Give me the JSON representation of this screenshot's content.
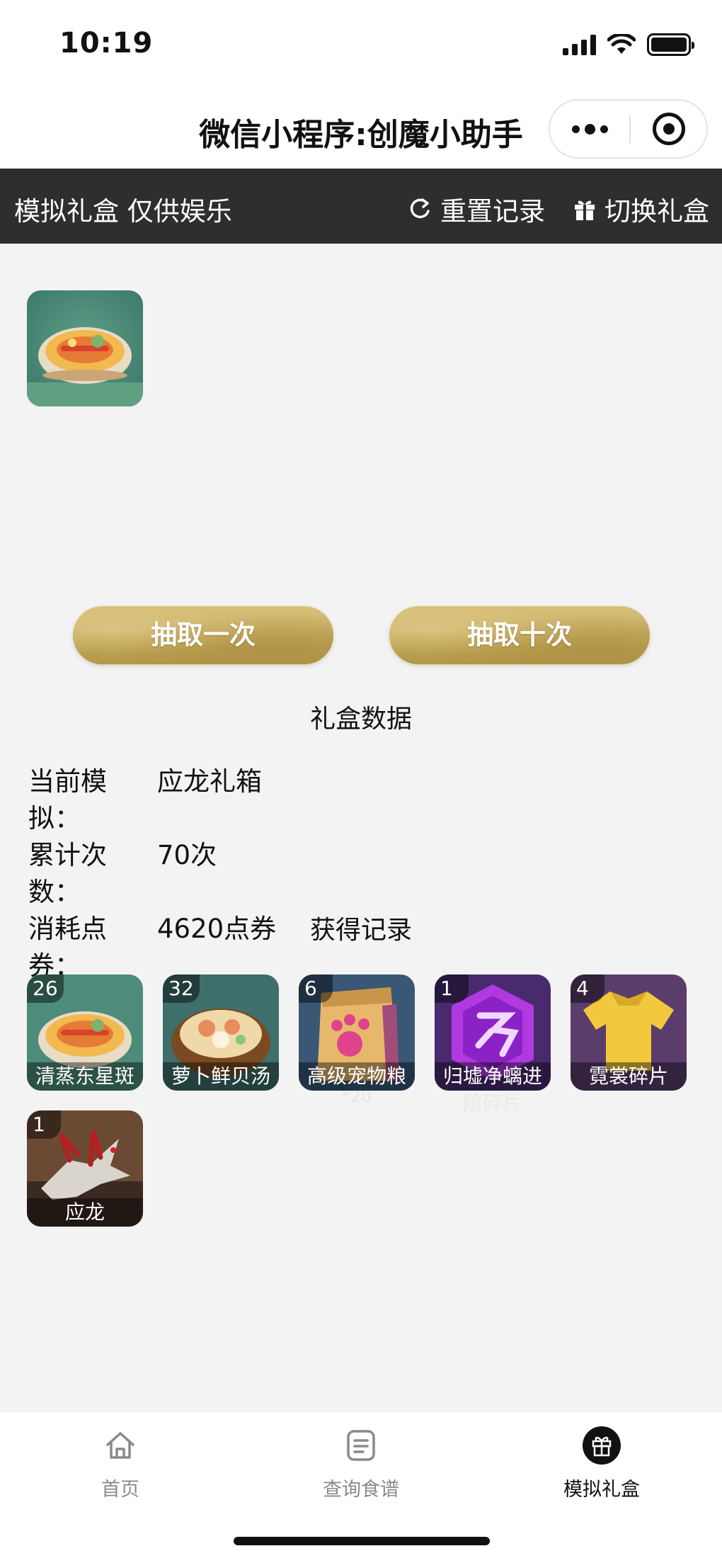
{
  "status_bar": {
    "time": "10:19"
  },
  "nav": {
    "title": "微信小程序:创魔小助手"
  },
  "top_bar": {
    "left_text": "模拟礼盒 仅供娱乐",
    "reset_label": "重置记录",
    "switch_label": "切换礼盒"
  },
  "buttons": {
    "draw_one": "抽取一次",
    "draw_ten": "抽取十次"
  },
  "stats": {
    "title": "礼盒数据",
    "rows": [
      {
        "label": "当前模拟：",
        "value": "应龙礼箱"
      },
      {
        "label": "累计次数：",
        "value": "70次"
      },
      {
        "label": "消耗点券：",
        "value": "4620点券"
      }
    ]
  },
  "records": {
    "title": "获得记录",
    "items": [
      {
        "count": "26",
        "name": "清蒸东星斑"
      },
      {
        "count": "32",
        "name": "萝卜鲜贝汤"
      },
      {
        "count": "6",
        "name": "高级宠物粮",
        "sub": "*20"
      },
      {
        "count": "1",
        "name": "归墟净螭进",
        "name2": "阶碎片"
      },
      {
        "count": "4",
        "name": "霓裳碎片"
      },
      {
        "count": "1",
        "name": "应龙"
      }
    ]
  },
  "tabbar": {
    "home": "首页",
    "recipes": "查询食谱",
    "giftbox": "模拟礼盒"
  },
  "colors": {
    "topbar_bg": "#2e2e2e",
    "button_gold": "#c9ae62",
    "page_bg": "#f3f3f4"
  }
}
